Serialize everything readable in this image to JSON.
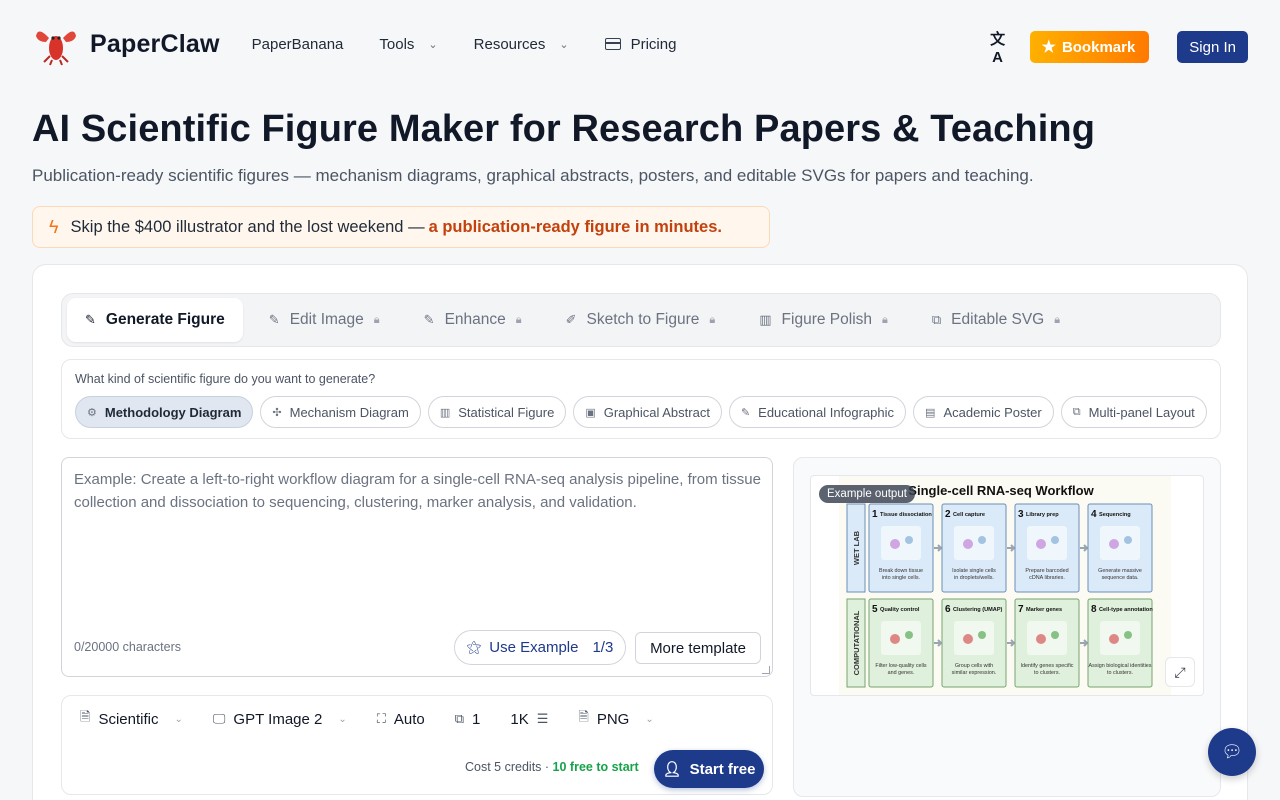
{
  "brand": {
    "name": "PaperClaw"
  },
  "nav": {
    "items": [
      {
        "label": "PaperBanana",
        "dropdown": false
      },
      {
        "label": "Tools",
        "dropdown": true
      },
      {
        "label": "Resources",
        "dropdown": true
      },
      {
        "label": "Pricing",
        "dropdown": false
      }
    ],
    "bookmark_label": "Bookmark",
    "signin_label": "Sign In"
  },
  "hero": {
    "title": "AI Scientific Figure Maker for Research Papers & Teaching",
    "subtitle": "Publication-ready scientific figures — mechanism diagrams, graphical abstracts, posters, and editable SVGs for papers and teaching.",
    "promo_text": "Skip the $400 illustrator and the lost weekend —",
    "promo_highlight": "a publication-ready figure in minutes."
  },
  "tabs": [
    {
      "label": "Generate Figure",
      "active": true,
      "locked": false
    },
    {
      "label": "Edit Image",
      "active": false,
      "locked": true
    },
    {
      "label": "Enhance",
      "active": false,
      "locked": true
    },
    {
      "label": "Sketch to Figure",
      "active": false,
      "locked": true
    },
    {
      "label": "Figure Polish",
      "active": false,
      "locked": true
    },
    {
      "label": "Editable SVG",
      "active": false,
      "locked": true
    }
  ],
  "figure_types": {
    "question": "What kind of scientific figure do you want to generate?",
    "options": [
      {
        "label": "Methodology Diagram",
        "active": true
      },
      {
        "label": "Mechanism Diagram",
        "active": false
      },
      {
        "label": "Statistical Figure",
        "active": false
      },
      {
        "label": "Graphical Abstract",
        "active": false
      },
      {
        "label": "Educational Infographic",
        "active": false
      },
      {
        "label": "Academic Poster",
        "active": false
      },
      {
        "label": "Multi-panel Layout",
        "active": false
      }
    ]
  },
  "prompt": {
    "placeholder": "Example: Create a left-to-right workflow diagram for a single-cell RNA-seq analysis pipeline, from tissue collection and dissociation to sequencing, clustering, marker analysis, and validation.",
    "value": "",
    "char_count": "0/20000 characters",
    "use_example_label": "Use Example",
    "use_example_counter": "1/3",
    "more_template_label": "More template"
  },
  "options": {
    "style": "Scientific",
    "model": "GPT Image 2",
    "aspect": "Auto",
    "count": "1",
    "resolution": "1K",
    "format": "PNG"
  },
  "cost": {
    "text": "Cost 5 credits ·",
    "free_text": "10 free to start"
  },
  "start_label": "Start free",
  "preview": {
    "badge": "Example output",
    "title": "Single-cell RNA-seq Workflow",
    "row_labels": [
      "WET LAB",
      "COMPUTATIONAL"
    ],
    "steps": [
      {
        "num": "1",
        "title": "Tissue dissociation",
        "caption": "Break down tissue into single cells."
      },
      {
        "num": "2",
        "title": "Cell capture",
        "caption": "Isolate single cells in droplets/wells."
      },
      {
        "num": "3",
        "title": "Library prep",
        "caption": "Prepare barcoded cDNA libraries."
      },
      {
        "num": "4",
        "title": "Sequencing",
        "caption": "Generate massive sequence data."
      },
      {
        "num": "5",
        "title": "Quality control",
        "caption": "Filter low-quality cells and genes."
      },
      {
        "num": "6",
        "title": "Clustering (UMAP)",
        "caption": "Group cells with similar expression."
      },
      {
        "num": "7",
        "title": "Marker genes",
        "caption": "Identify genes specific to clusters."
      },
      {
        "num": "8",
        "title": "Cell-type annotation",
        "caption": "Assign biological identities to clusters."
      }
    ],
    "colors": {
      "wet": "#dbeaf8",
      "comp": "#dff0dc",
      "wet_border": "#6b8fb6",
      "comp_border": "#7aa36f"
    }
  },
  "colors": {
    "primary": "#1e3a8a",
    "accent": "#ff8c00",
    "free": "#16a34a",
    "promo": "#c2410c"
  }
}
